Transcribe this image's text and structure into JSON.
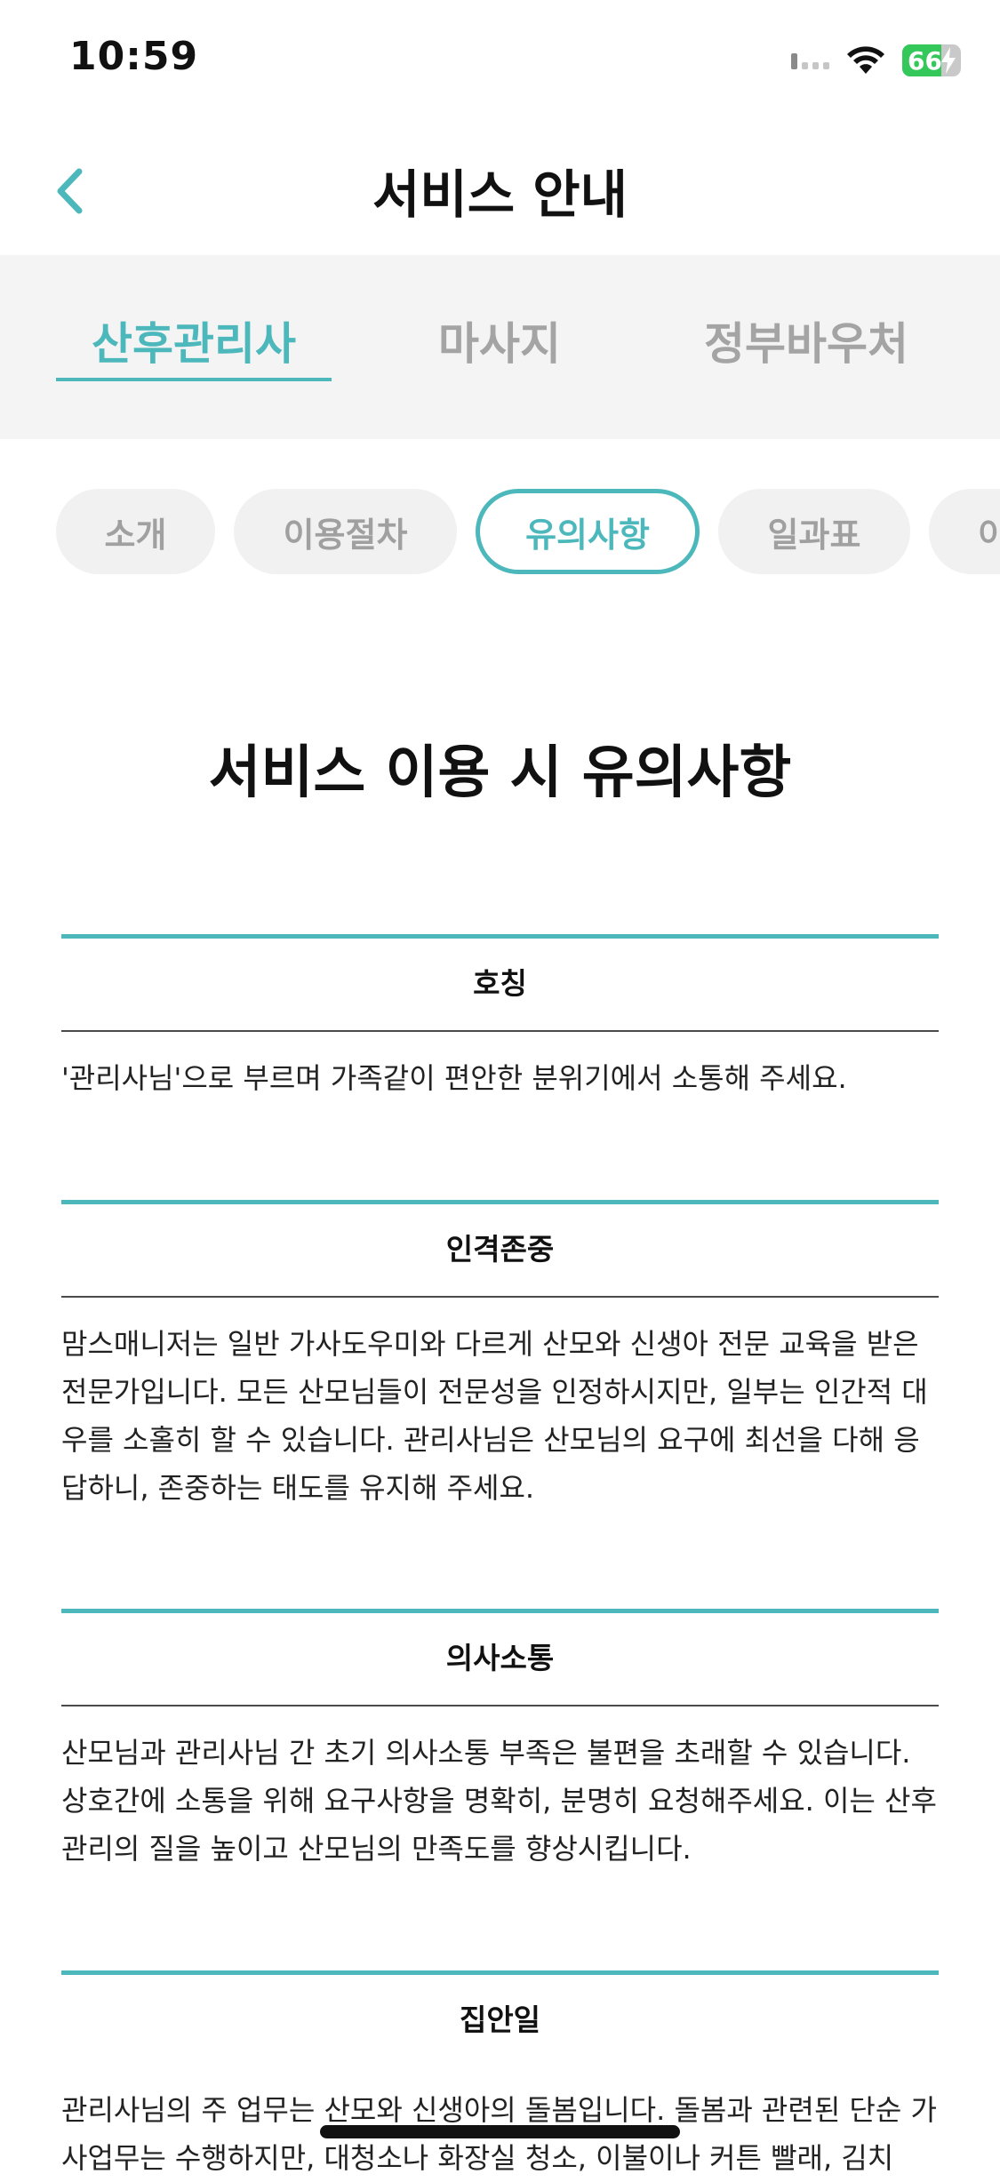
{
  "status_bar": {
    "time": "10:59",
    "battery_percent": "66",
    "battery_level": 0.66
  },
  "header": {
    "title": "서비스 안내",
    "back_icon": "chevron-left-icon"
  },
  "main_tabs": [
    {
      "label": "산후관리사",
      "active": true
    },
    {
      "label": "마사지",
      "active": false
    },
    {
      "label": "정부바우처",
      "active": false
    }
  ],
  "sub_tabs": [
    {
      "label": "소개",
      "active": false
    },
    {
      "label": "이용절차",
      "active": false
    },
    {
      "label": "유의사항",
      "active": true
    },
    {
      "label": "일과표",
      "active": false
    },
    {
      "label": "이",
      "active": false
    }
  ],
  "content": {
    "title": "서비스 이용 시 유의사항",
    "sections": [
      {
        "heading": "호칭",
        "body": "'관리사님'으로 부르며 가족같이 편안한 분위기에서 소통해 주세요."
      },
      {
        "heading": "인격존중",
        "body": "맘스매니저는 일반 가사도우미와 다르게 산모와 신생아 전문 교육을 받은 전문가입니다. 모든 산모님들이 전문성을 인정하시지만, 일부는 인간적 대우를 소홀히 할 수 있습니다. 관리사님은 산모님의 요구에 최선을 다해 응답하니, 존중하는 태도를 유지해 주세요."
      },
      {
        "heading": "의사소통",
        "body": "산모님과 관리사님 간 초기 의사소통 부족은 불편을 초래할 수 있습니다. 상호간에 소통을 위해 요구사항을 명확히, 분명히 요청해주세요. 이는 산후 관리의 질을 높이고 산모님의 만족도를 향상시킵니다."
      },
      {
        "heading": "집안일",
        "body": "관리사님의 주 업무는 산모와 신생아의 돌봄입니다. 돌봄과 관련된 단순 가사업무는 수행하지만, 대청소나 화장실 청소, 이불이나 커튼 빨래, 김치"
      }
    ]
  },
  "colors": {
    "accent": "#4cb8bb",
    "tab_bg": "#f4f4f4",
    "inactive_text": "#a4a4a4",
    "battery_green": "#34c759"
  }
}
